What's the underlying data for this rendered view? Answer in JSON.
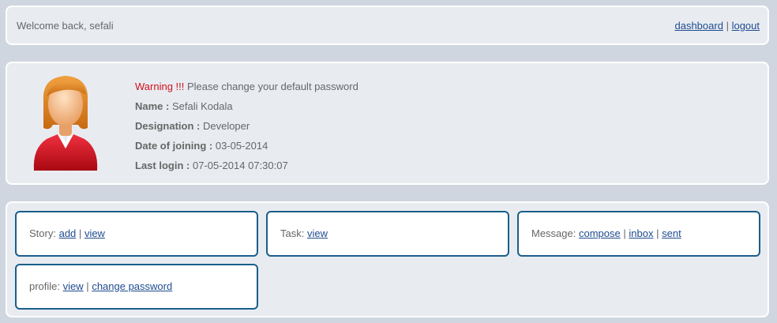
{
  "header": {
    "welcome": "Welcome back, sefali",
    "dashboard_link": "dashboard",
    "separator": "|",
    "logout_link": "logout"
  },
  "profile": {
    "warning_label": "Warning !!!",
    "warning_text": "Please change your default password",
    "name_label": "Name :",
    "name_value": "Sefali Kodala",
    "designation_label": "Designation :",
    "designation_value": "Developer",
    "joining_label": "Date of joining :",
    "joining_value": "03-05-2014",
    "last_login_label": "Last login :",
    "last_login_value": "07-05-2014 07:30:07"
  },
  "cards": {
    "story": {
      "label": "Story:",
      "links": [
        "add",
        "view"
      ]
    },
    "task": {
      "label": "Task:",
      "links": [
        "view"
      ]
    },
    "message": {
      "label": "Message:",
      "links": [
        "compose",
        "inbox",
        "sent"
      ]
    },
    "profile": {
      "label": "profile:",
      "links": [
        "view",
        "change password"
      ]
    }
  },
  "icons": {
    "avatar": "user-avatar-female"
  },
  "colors": {
    "warning": "#d0101a",
    "link": "#1f4b8f",
    "card_border": "#1a5f8a"
  }
}
